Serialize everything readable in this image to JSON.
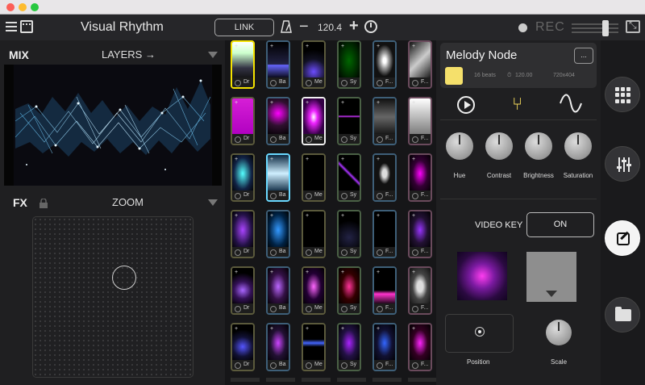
{
  "window": {
    "title": "Visual Rhythm"
  },
  "topbar": {
    "app_title": "Visual Rhythm",
    "link_label": "LINK",
    "tempo": "120.4",
    "minus": "−",
    "plus": "+",
    "rec_label": "REC"
  },
  "mix": {
    "label": "MIX",
    "layers_label": "LAYERS →"
  },
  "fx": {
    "label": "FX",
    "effect": "ZOOM"
  },
  "grid": {
    "columns": [
      {
        "cap": "Dr"
      },
      {
        "cap": "Ba"
      },
      {
        "cap": "Me"
      },
      {
        "cap": "Sy"
      },
      {
        "cap": "F..."
      },
      {
        "cap": "F..."
      }
    ]
  },
  "node": {
    "title": "Melody Node",
    "more_label": "...",
    "beats": "16 beats",
    "bpm": "120.00",
    "resolution": "720x404",
    "swatch_color": "#f5e06b",
    "knobs": [
      {
        "label": "Hue"
      },
      {
        "label": "Contrast"
      },
      {
        "label": "Brightness"
      },
      {
        "label": "Saturation"
      }
    ],
    "video_key_label": "VIDEO KEY",
    "video_key_state": "ON",
    "position_label": "Position",
    "scale_label": "Scale"
  },
  "sidebar": {
    "items": [
      {
        "icon": "grid-icon"
      },
      {
        "icon": "sliders-icon"
      },
      {
        "icon": "edit-icon"
      },
      {
        "icon": "folder-icon"
      }
    ]
  },
  "colors": {
    "accent_yellow": "#f5e300",
    "accent_blue": "#6ad9ff",
    "background": "#1c1c1e"
  }
}
